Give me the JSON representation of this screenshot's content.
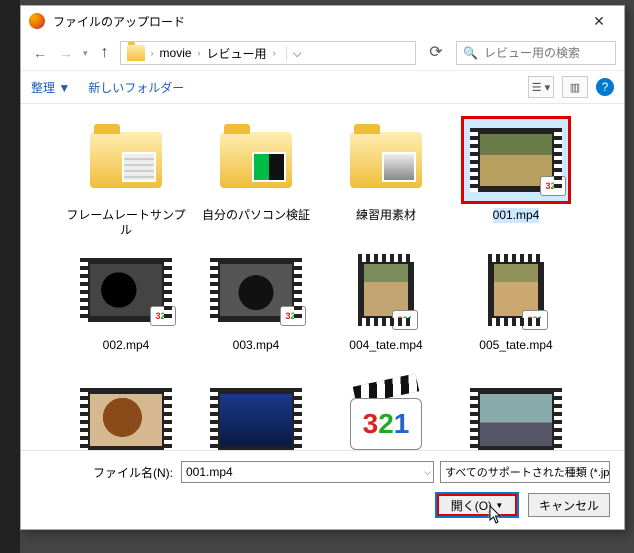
{
  "title": "ファイルのアップロード",
  "breadcrumb": {
    "seg1": "movie",
    "seg2": "レビュー用"
  },
  "search": {
    "placeholder": "レビュー用の検索"
  },
  "toolbar": {
    "organize": "整理",
    "new_folder": "新しいフォルダー"
  },
  "items": [
    {
      "label": "フレームレートサンプル"
    },
    {
      "label": "自分のパソコン検証"
    },
    {
      "label": "練習用素材"
    },
    {
      "label": "001.mp4"
    },
    {
      "label": "002.mp4"
    },
    {
      "label": "003.mp4"
    },
    {
      "label": "004_tate.mp4"
    },
    {
      "label": "005_tate.mp4"
    }
  ],
  "filename": {
    "label": "ファイル名(N):",
    "value": "001.mp4"
  },
  "filetype": {
    "label": "すべてのサポートされた種類 (*.jpe;"
  },
  "buttons": {
    "open": "開く(O)",
    "cancel": "キャンセル"
  }
}
